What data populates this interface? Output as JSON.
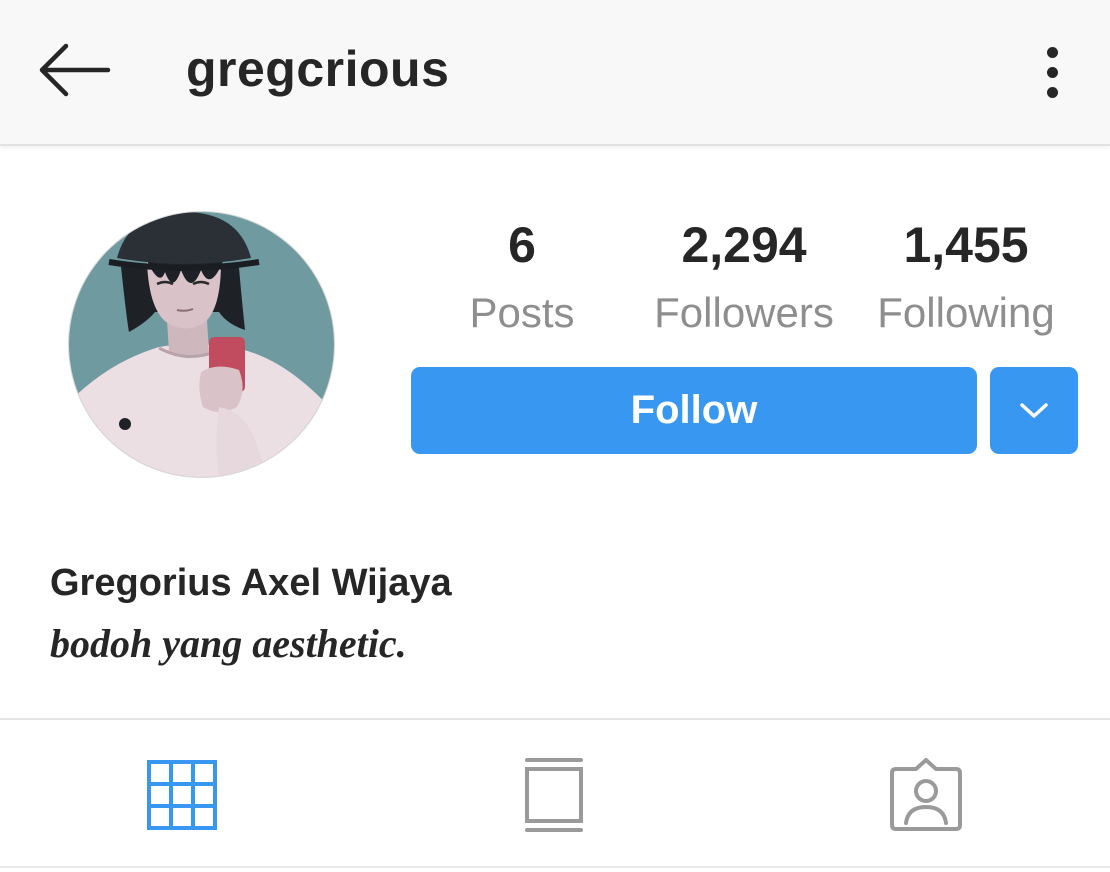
{
  "header": {
    "username": "gregcrious",
    "back_icon": "arrow-left-icon",
    "more_icon": "more-vertical-icon"
  },
  "profile": {
    "avatar": "profile-photo",
    "stats": [
      {
        "value": "6",
        "label": "Posts"
      },
      {
        "value": "2,294",
        "label": "Followers"
      },
      {
        "value": "1,455",
        "label": "Following"
      }
    ],
    "follow_label": "Follow",
    "dropdown_icon": "chevron-down-icon",
    "full_name": "Gregorius Axel Wijaya",
    "bio": "bodoh yang aesthetic."
  },
  "tabs": [
    {
      "icon": "grid-icon",
      "active": true
    },
    {
      "icon": "feed-icon",
      "active": false
    },
    {
      "icon": "tagged-icon",
      "active": false
    }
  ],
  "colors": {
    "accent": "#3897f0",
    "text": "#262626",
    "muted": "#8e8e8e",
    "inactive_icon": "#9a9a9a",
    "header_bg": "#f8f8f8"
  }
}
